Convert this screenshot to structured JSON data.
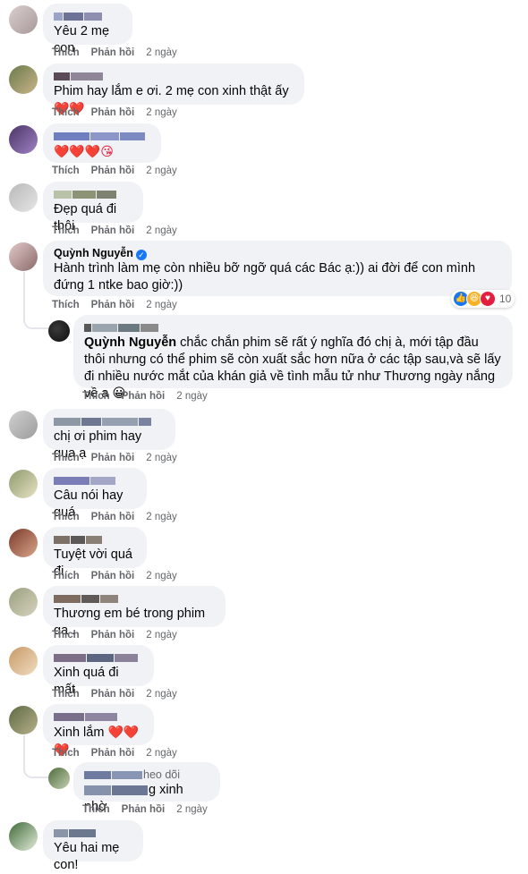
{
  "actions": {
    "like": "Thích",
    "reply": "Phản hồi"
  },
  "colors": {
    "heart": "#e41e3f",
    "bubble": "#f0f2f5",
    "meta": "#65676b",
    "verified": "#1877f2"
  },
  "comments": [
    {
      "author": "",
      "text": "Yêu 2 mẹ con",
      "time": "2 ngày"
    },
    {
      "author": "",
      "text": "Phim hay lắm e ơi. 2 mẹ con xinh thật ấy",
      "emoji": "❤️❤️",
      "time": "2 ngày"
    },
    {
      "author": "",
      "text": "",
      "emoji": "❤️❤️❤️😘",
      "time": "2 ngày"
    },
    {
      "author": "",
      "text": "Đẹp quá đi thôi",
      "time": "2 ngày"
    },
    {
      "author": "Quỳnh Nguyễn",
      "text": "Hành trình làm mẹ còn nhiều bỡ ngỡ quá các Bác ạ:)) ai đời để con mình đứng 1 ntke bao giờ:))",
      "reaction_count": "10",
      "time": "2 ngày"
    },
    {
      "author": "",
      "mention": "Quỳnh Nguyễn",
      "text": "chắc chắn phim sẽ rất ý nghĩa đó chị à, mới tập đầu thôi nhưng có thể phim sẽ còn xuất sắc hơn nữa ở các tập sau,và sẽ lấy đi nhiều nước mắt của khán giả về tình mẫu tử như Thương ngày nắng về ạ",
      "emoji": "😀",
      "time": "2 ngày"
    },
    {
      "author": "",
      "text": "chị ơi phim hay qua ạ",
      "time": "2 ngày"
    },
    {
      "author": "",
      "text": "Câu nói hay quá",
      "time": "2 ngày"
    },
    {
      "author": "",
      "text": "Tuyệt vời quá đi",
      "time": "2 ngày"
    },
    {
      "author": "",
      "text": "Thương em bé trong phim qa .",
      "time": "2 ngày"
    },
    {
      "author": "",
      "text": "Xinh quá đi mất",
      "time": "2 ngày"
    },
    {
      "author": "",
      "text": "Xinh lắm",
      "emoji": "❤️❤️❤️",
      "time": "2 ngày"
    },
    {
      "author": "",
      "author_suffix": "heo dõi",
      "text": "g xinh nhờ",
      "time": "2 ngày"
    },
    {
      "author": "",
      "text": "Yêu hai mẹ con!",
      "time": ""
    }
  ]
}
